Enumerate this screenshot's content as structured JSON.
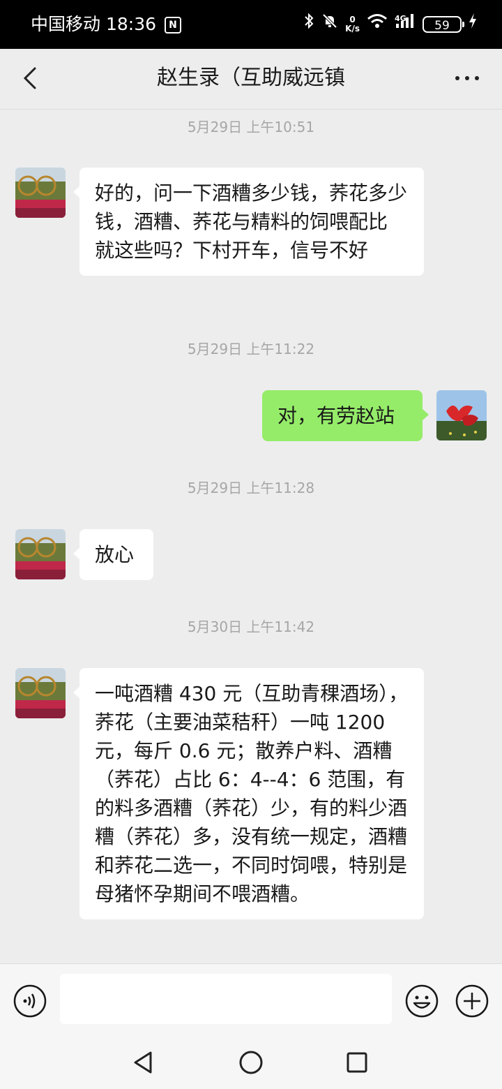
{
  "status_bar": {
    "carrier": "中国移动",
    "time": "18:36",
    "nfc": "N",
    "net_speed_value": "0",
    "net_speed_unit": "K/s",
    "network": "4G",
    "battery": "59"
  },
  "header": {
    "title": "赵生录（互助威远镇"
  },
  "messages": [
    {
      "timestamp": "5月29日 上午10:51",
      "side": "left",
      "text": "好的，问一下酒糟多少钱，荞花多少钱，酒糟、荞花与精料的饲喂配比　就这些吗？下村开车，信号不好"
    },
    {
      "timestamp": "5月29日 上午11:22",
      "side": "right",
      "text": "对，有劳赵站"
    },
    {
      "timestamp": "5月29日 上午11:28",
      "side": "left",
      "text": "放心"
    },
    {
      "timestamp": "5月30日 上午11:42",
      "side": "left",
      "text": "一吨酒糟 430 元（互助青稞酒场），荞花（主要油菜秸秆）一吨 1200 元，每斤 0.6 元；散养户料、酒糟（荞花）占比 6：4--4：6 范围，有的料多酒糟（荞花）少，有的料少酒糟（荞花）多，没有统一规定，酒糟和荞花二选一，不同时饲喂，特别是母猪怀孕期间不喂酒糟。"
    }
  ],
  "input_bar": {
    "placeholder": ""
  },
  "icons": {
    "back": "chevron-left-icon",
    "more": "more-dots-icon",
    "voice": "voice-icon",
    "emoji": "emoji-icon",
    "plus": "plus-icon",
    "nav_back": "nav-back-icon",
    "nav_home": "nav-home-icon",
    "nav_recent": "nav-recent-icon"
  },
  "colors": {
    "outgoing_bubble": "#95ec69",
    "incoming_bubble": "#ffffff",
    "background": "#ededed"
  }
}
